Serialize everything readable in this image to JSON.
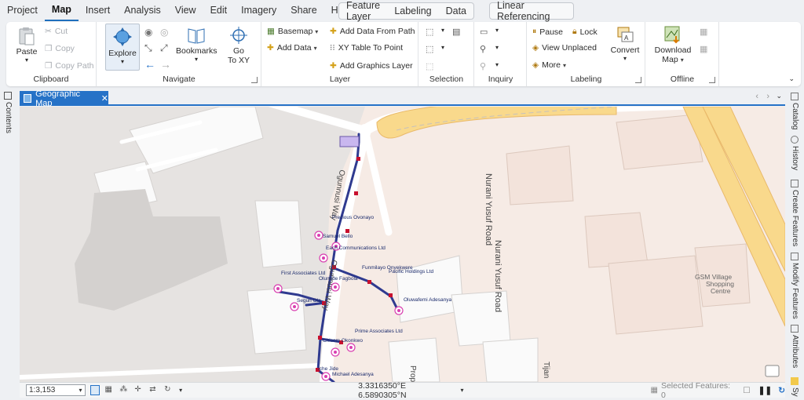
{
  "menu": {
    "items": [
      {
        "label": "Project"
      },
      {
        "label": "Map",
        "active": true
      },
      {
        "label": "Insert"
      },
      {
        "label": "Analysis"
      },
      {
        "label": "View"
      },
      {
        "label": "Edit"
      },
      {
        "label": "Imagery"
      },
      {
        "label": "Share"
      },
      {
        "label": "Help"
      }
    ],
    "context_group_1": [
      "Feature Layer",
      "Labeling",
      "Data"
    ],
    "context_group_2": [
      "Linear Referencing"
    ]
  },
  "ribbon": {
    "clipboard": {
      "label": "Clipboard",
      "paste": "Paste",
      "cut": "Cut",
      "copy": "Copy",
      "copy_path": "Copy Path"
    },
    "navigate": {
      "label": "Navigate",
      "explore": "Explore",
      "bookmarks": "Bookmarks",
      "go_to_xy_1": "Go",
      "go_to_xy_2": "To XY"
    },
    "layer": {
      "label": "Layer",
      "basemap": "Basemap",
      "add_data": "Add Data",
      "add_data_from_path": "Add Data From Path",
      "xy_table_to_point": "XY Table To Point",
      "add_graphics_layer": "Add Graphics Layer"
    },
    "selection": {
      "label": "Selection"
    },
    "inquiry": {
      "label": "Inquiry"
    },
    "labeling": {
      "label": "Labeling",
      "pause": "Pause",
      "lock": "Lock",
      "view_unplaced": "View Unplaced",
      "more": "More",
      "convert": "Convert"
    },
    "offline": {
      "label": "Offline",
      "download_map_1": "Download",
      "download_map_2": "Map"
    }
  },
  "side_tabs": {
    "left": [
      "Contents"
    ],
    "right": [
      "Catalog",
      "History",
      "Create Features",
      "Modify Features",
      "Attributes",
      "Sy"
    ]
  },
  "map_tab": {
    "title": "Geographic Map"
  },
  "map": {
    "road_labels": [
      "Nurani Yusuf Road",
      "Nurani Yusuf Road",
      "Ogunnusi Way",
      "Ogunnusi Way",
      "Tijan",
      "Prop"
    ],
    "place_labels": [
      "GSM Village",
      "Shopping",
      "Centre"
    ],
    "points": [
      {
        "name": "Precious Ovonayo"
      },
      {
        "name": "Samuel Bello"
      },
      {
        "name": "Each Communications Ltd"
      },
      {
        "name": "First Associates Ltd"
      },
      {
        "name": "Olumide Fagbola"
      },
      {
        "name": "Segun Ola"
      },
      {
        "name": "Funmilayo Onyekwere"
      },
      {
        "name": "Pacific Holdings Ltd"
      },
      {
        "name": "Oluwafemi Adesanya"
      },
      {
        "name": "Prime Associates Ltd"
      },
      {
        "name": "Chisom Okonkwo"
      },
      {
        "name": "Iche Jide"
      },
      {
        "name": "Michael Adesanya"
      }
    ]
  },
  "status": {
    "scale": "1:3,153",
    "coordinates": "3.3316350°E 6.5890305°N",
    "selected_features": "Selected Features: 0"
  },
  "colors": {
    "accent": "#2672c7",
    "network_line": "#2f3a8f",
    "node": "#c8102e",
    "poi": "#d93fb0",
    "highway": "#f7d58a"
  }
}
